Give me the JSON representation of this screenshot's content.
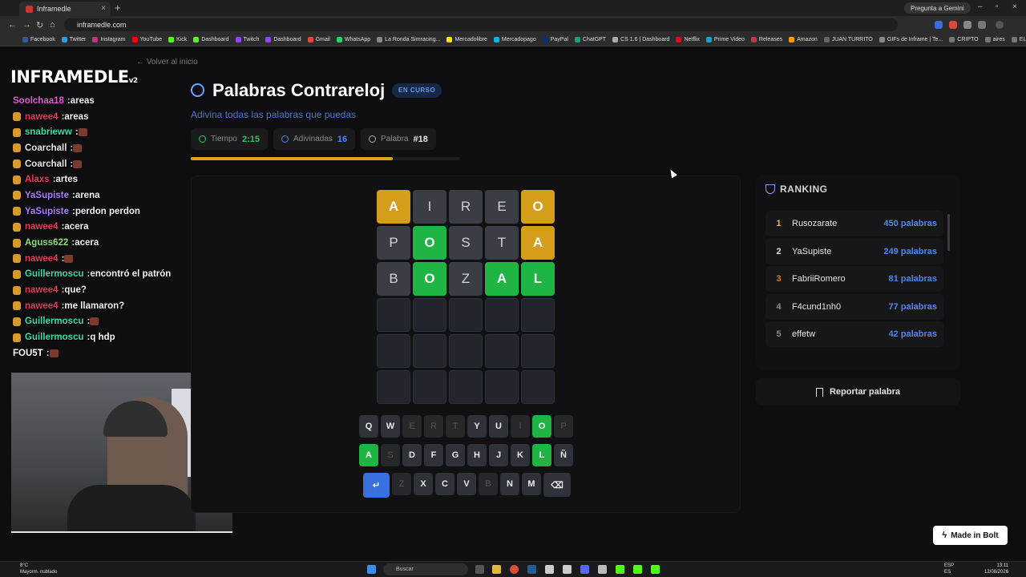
{
  "browser": {
    "tab_title": "Inframedle",
    "url": "inframedle.com",
    "gemini_label": "Pregunta a Gemini",
    "bookmarks": [
      "Facebook",
      "Twitter",
      "Instagram",
      "YouTube",
      "Kick",
      "Dashboard",
      "Twitch",
      "Dashboard",
      "Gmail",
      "WhatsApp",
      "La Ronda Simracing...",
      "Mercadolibre",
      "Mercadopago",
      "PayPal",
      "ChatGPT",
      "CS 1.6 | Dashboard",
      "Netflix",
      "Prime Video",
      "Releases",
      "Amazon",
      "JUAN TURRITO",
      "GIFs de Inframe | Te...",
      "CRIPTO",
      "aires",
      "EL MEGA PACK PAP..."
    ]
  },
  "overlay": {
    "logo": "INFRAMEDLE",
    "logo_version": "v2",
    "chat": [
      {
        "user": "Soolchaa18",
        "color": "#e05ad8",
        "text": "areas"
      },
      {
        "user": "nawee4",
        "color": "#e33b5b",
        "text": "areas"
      },
      {
        "user": "snabrieww",
        "color": "#43d9a6",
        "text": ""
      },
      {
        "user": "Coarchall",
        "color": "#e6e6e6",
        "text": ""
      },
      {
        "user": "Coarchall",
        "color": "#e6e6e6",
        "text": ""
      },
      {
        "user": "Alaxs",
        "color": "#e33b5b",
        "text": "artes"
      },
      {
        "user": "YaSupiste",
        "color": "#a97bff",
        "text": "arena"
      },
      {
        "user": "YaSupiste",
        "color": "#a97bff",
        "text": "perdon perdon"
      },
      {
        "user": "nawee4",
        "color": "#e33b5b",
        "text": "acera"
      },
      {
        "user": "Aguss622",
        "color": "#8ce36a",
        "text": "acera"
      },
      {
        "user": "nawee4",
        "color": "#e33b5b",
        "text": ""
      },
      {
        "user": "Guillermoscu",
        "color": "#43d9a6",
        "text": "encontró el patrón"
      },
      {
        "user": "nawee4",
        "color": "#e33b5b",
        "text": "que?"
      },
      {
        "user": "nawee4",
        "color": "#e33b5b",
        "text": "me llamaron?"
      },
      {
        "user": "Guillermoscu",
        "color": "#43d9a6",
        "text": ""
      },
      {
        "user": "Guillermoscu",
        "color": "#43d9a6",
        "text": "q hdp"
      },
      {
        "user": "FOU5T",
        "color": "#ffffff",
        "text": ""
      }
    ]
  },
  "header": {
    "back_label": "Volver al inicio",
    "title": "Palabras Contrareloj",
    "status": "EN CURSO",
    "subtitle": "Adivina todas las palabras que puedas"
  },
  "stats": {
    "time_label": "Tiempo",
    "time_value": "2:15",
    "guessed_label": "Adivinadas",
    "guessed_value": "16",
    "word_label": "Palabra",
    "word_value": "#18"
  },
  "progress": {
    "fraction": 0.75
  },
  "board": {
    "rows": [
      [
        {
          "l": "A",
          "s": "yellow"
        },
        {
          "l": "I",
          "s": "grey"
        },
        {
          "l": "R",
          "s": "grey"
        },
        {
          "l": "E",
          "s": "grey"
        },
        {
          "l": "O",
          "s": "yellow"
        }
      ],
      [
        {
          "l": "P",
          "s": "grey"
        },
        {
          "l": "O",
          "s": "green"
        },
        {
          "l": "S",
          "s": "grey"
        },
        {
          "l": "T",
          "s": "grey"
        },
        {
          "l": "A",
          "s": "yellow"
        }
      ],
      [
        {
          "l": "B",
          "s": "grey"
        },
        {
          "l": "O",
          "s": "green"
        },
        {
          "l": "Z",
          "s": "grey"
        },
        {
          "l": "A",
          "s": "green"
        },
        {
          "l": "L",
          "s": "green"
        }
      ],
      [
        {
          "l": "",
          "s": "empty"
        },
        {
          "l": "",
          "s": "empty"
        },
        {
          "l": "",
          "s": "empty"
        },
        {
          "l": "",
          "s": "empty"
        },
        {
          "l": "",
          "s": "empty"
        }
      ],
      [
        {
          "l": "",
          "s": "empty"
        },
        {
          "l": "",
          "s": "empty"
        },
        {
          "l": "",
          "s": "empty"
        },
        {
          "l": "",
          "s": "empty"
        },
        {
          "l": "",
          "s": "empty"
        }
      ],
      [
        {
          "l": "",
          "s": "empty"
        },
        {
          "l": "",
          "s": "empty"
        },
        {
          "l": "",
          "s": "empty"
        },
        {
          "l": "",
          "s": "empty"
        },
        {
          "l": "",
          "s": "empty"
        }
      ]
    ]
  },
  "keyboard": {
    "rows": [
      [
        {
          "k": "Q",
          "s": "normal"
        },
        {
          "k": "W",
          "s": "normal"
        },
        {
          "k": "E",
          "s": "used"
        },
        {
          "k": "R",
          "s": "used"
        },
        {
          "k": "T",
          "s": "used"
        },
        {
          "k": "Y",
          "s": "normal"
        },
        {
          "k": "U",
          "s": "normal"
        },
        {
          "k": "I",
          "s": "used"
        },
        {
          "k": "O",
          "s": "green"
        },
        {
          "k": "P",
          "s": "used"
        }
      ],
      [
        {
          "k": "A",
          "s": "green"
        },
        {
          "k": "S",
          "s": "used"
        },
        {
          "k": "D",
          "s": "normal"
        },
        {
          "k": "F",
          "s": "normal"
        },
        {
          "k": "G",
          "s": "normal"
        },
        {
          "k": "H",
          "s": "normal"
        },
        {
          "k": "J",
          "s": "normal"
        },
        {
          "k": "K",
          "s": "normal"
        },
        {
          "k": "L",
          "s": "green"
        },
        {
          "k": "Ñ",
          "s": "normal"
        }
      ],
      [
        {
          "k": "↵",
          "s": "enter"
        },
        {
          "k": "Z",
          "s": "used"
        },
        {
          "k": "X",
          "s": "normal"
        },
        {
          "k": "C",
          "s": "normal"
        },
        {
          "k": "V",
          "s": "normal"
        },
        {
          "k": "B",
          "s": "used"
        },
        {
          "k": "N",
          "s": "normal"
        },
        {
          "k": "M",
          "s": "normal"
        },
        {
          "k": "⌫",
          "s": "del"
        }
      ]
    ]
  },
  "ranking": {
    "title": "RANKING",
    "entries": [
      {
        "pos": "1",
        "name": "Rusozarate",
        "pts": "450 palabras",
        "pos_color": "#f0b429"
      },
      {
        "pos": "2",
        "name": "YaSupiste",
        "pts": "249 palabras",
        "pos_color": "#e0e0e0"
      },
      {
        "pos": "3",
        "name": "FabriiRomero",
        "pts": "81 palabras",
        "pos_color": "#e07a1f"
      },
      {
        "pos": "4",
        "name": "F4cund1nh0",
        "pts": "77 palabras",
        "pos_color": "#8a8a8a"
      },
      {
        "pos": "5",
        "name": "effetw",
        "pts": "42 palabras",
        "pos_color": "#8a8a8a"
      }
    ],
    "report_label": "Reportar palabra"
  },
  "bolt_label": "Made in Bolt",
  "taskbar": {
    "weather_temp": "8°C",
    "weather_desc": "Mayorm. nublado",
    "search_placeholder": "Buscar",
    "lang": "ESP",
    "lang2": "ES",
    "time": "13:11",
    "date": "12/08/2026"
  },
  "icons": {
    "title": "stopwatch-icon",
    "stats": [
      "clock-icon",
      "trophy-icon",
      "stopwatch-icon"
    ],
    "ranking": "trophy-icon",
    "report": "flag-icon"
  }
}
